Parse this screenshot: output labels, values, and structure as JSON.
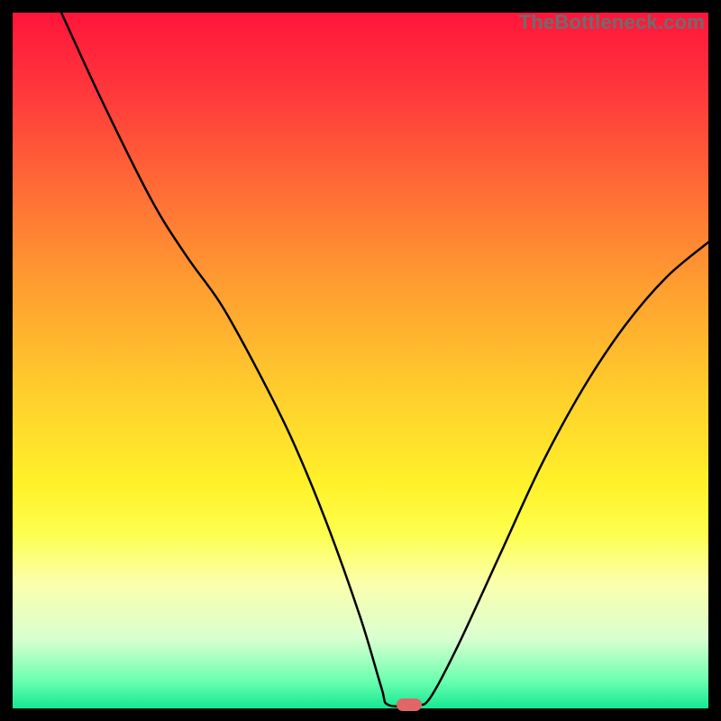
{
  "watermark": "TheBottleneck.com",
  "gradient": {
    "stops": [
      {
        "offset": 0.0,
        "color": "#ff153b"
      },
      {
        "offset": 0.12,
        "color": "#ff3a3c"
      },
      {
        "offset": 0.25,
        "color": "#ff6b36"
      },
      {
        "offset": 0.4,
        "color": "#ffa030"
      },
      {
        "offset": 0.55,
        "color": "#ffcf2c"
      },
      {
        "offset": 0.68,
        "color": "#fff22a"
      },
      {
        "offset": 0.75,
        "color": "#fdff4f"
      },
      {
        "offset": 0.82,
        "color": "#fbffac"
      },
      {
        "offset": 0.9,
        "color": "#d9ffd0"
      },
      {
        "offset": 0.96,
        "color": "#6cffb0"
      },
      {
        "offset": 1.0,
        "color": "#14e893"
      }
    ]
  },
  "chart_data": {
    "type": "line",
    "title": "",
    "xlabel": "",
    "ylabel": "",
    "xlim": [
      0,
      100
    ],
    "ylim": [
      0,
      100
    ],
    "grid": false,
    "series": [
      {
        "name": "curve",
        "points": [
          {
            "x": 7,
            "y": 100
          },
          {
            "x": 13,
            "y": 87
          },
          {
            "x": 20,
            "y": 73
          },
          {
            "x": 25,
            "y": 65
          },
          {
            "x": 30,
            "y": 58
          },
          {
            "x": 35,
            "y": 49
          },
          {
            "x": 40,
            "y": 39
          },
          {
            "x": 45,
            "y": 27
          },
          {
            "x": 50,
            "y": 13
          },
          {
            "x": 53,
            "y": 3
          },
          {
            "x": 54,
            "y": 0.5
          },
          {
            "x": 58,
            "y": 0.5
          },
          {
            "x": 60,
            "y": 1.5
          },
          {
            "x": 64,
            "y": 9
          },
          {
            "x": 70,
            "y": 22
          },
          {
            "x": 76,
            "y": 35
          },
          {
            "x": 82,
            "y": 46
          },
          {
            "x": 88,
            "y": 55
          },
          {
            "x": 94,
            "y": 62
          },
          {
            "x": 100,
            "y": 67
          }
        ]
      }
    ],
    "marker": {
      "x": 57,
      "y": 0.5,
      "color": "#e16666"
    },
    "curve_color": "#000000",
    "curve_width": 2.5
  }
}
